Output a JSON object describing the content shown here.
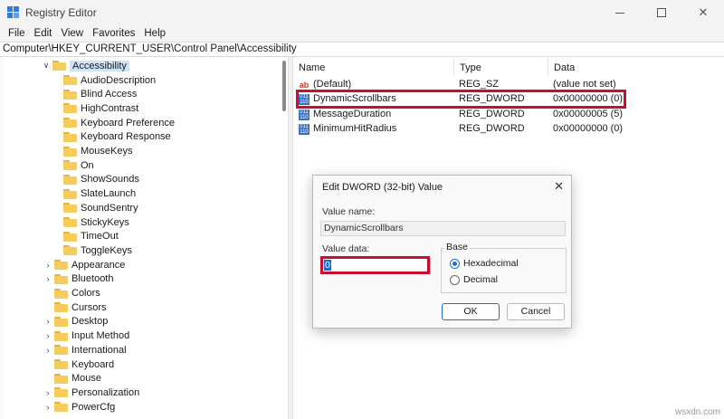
{
  "window": {
    "title": "Registry Editor",
    "controls": {
      "minimize": "—",
      "maximize": "☐",
      "close": "✕"
    }
  },
  "menu": [
    "File",
    "Edit",
    "View",
    "Favorites",
    "Help"
  ],
  "address": "Computer\\HKEY_CURRENT_USER\\Control Panel\\Accessibility",
  "tree": {
    "selected_key": "Accessibility",
    "children": [
      "AudioDescription",
      "Blind Access",
      "HighContrast",
      "Keyboard Preference",
      "Keyboard Response",
      "MouseKeys",
      "On",
      "ShowSounds",
      "SlateLaunch",
      "SoundSentry",
      "StickyKeys",
      "TimeOut",
      "ToggleKeys"
    ],
    "siblings": [
      "Appearance",
      "Bluetooth",
      "Colors",
      "Cursors",
      "Desktop",
      "Input Method",
      "International",
      "Keyboard",
      "Mouse",
      "Personalization",
      "PowerCfg"
    ]
  },
  "values_table": {
    "columns": [
      "Name",
      "Type",
      "Data"
    ],
    "rows": [
      {
        "icon": "string-value-icon",
        "name": "(Default)",
        "type": "REG_SZ",
        "data": "(value not set)"
      },
      {
        "icon": "binary-value-icon",
        "name": "DynamicScrollbars",
        "type": "REG_DWORD",
        "data": "0x00000000 (0)"
      },
      {
        "icon": "binary-value-icon",
        "name": "MessageDuration",
        "type": "REG_DWORD",
        "data": "0x00000005 (5)"
      },
      {
        "icon": "binary-value-icon",
        "name": "MinimumHitRadius",
        "type": "REG_DWORD",
        "data": "0x00000000 (0)"
      }
    ]
  },
  "dialog": {
    "title": "Edit DWORD (32-bit) Value",
    "close": "✕",
    "value_name_label": "Value name:",
    "value_name": "DynamicScrollbars",
    "value_data_label": "Value data:",
    "value_data": "0",
    "base_label": "Base",
    "base_options": [
      "Hexadecimal",
      "Decimal"
    ],
    "base_selected": "Hexadecimal",
    "ok": "OK",
    "cancel": "Cancel"
  },
  "accent_color": "#c8102e",
  "watermark": "wsxdn.com"
}
